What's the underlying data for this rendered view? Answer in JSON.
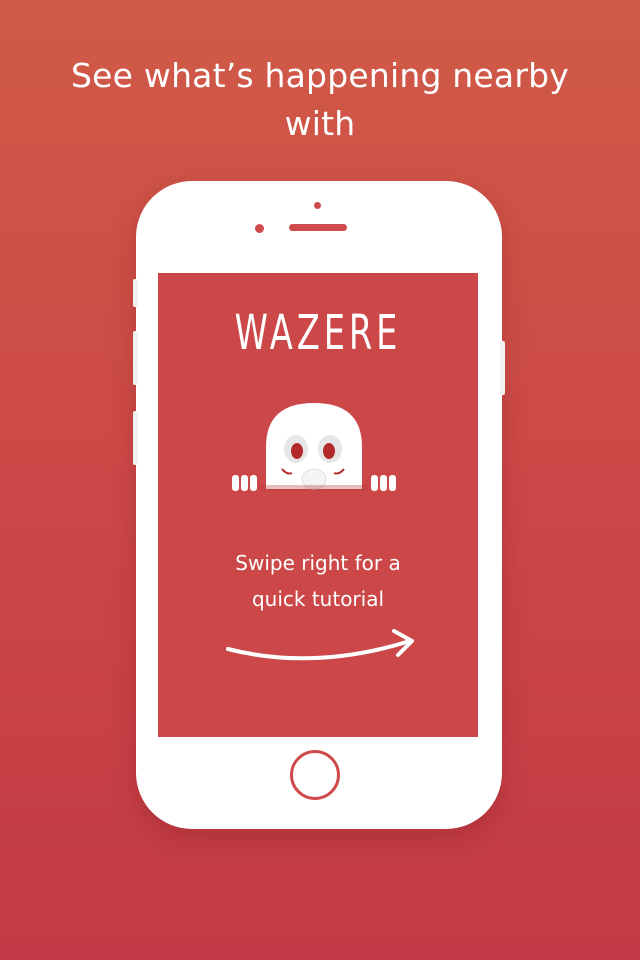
{
  "headline": {
    "line1": "See what’s happening nearby",
    "line2": "with"
  },
  "app": {
    "title": "WAZERE",
    "swipe_line1": "Swipe right for a",
    "swipe_line2": "quick tutorial"
  },
  "colors": {
    "background_top": "#d05a47",
    "background_bottom": "#c23a45",
    "screen": "#cc4848",
    "phone_body": "#ffffff"
  },
  "icons": {
    "mascot": "peeking-skull-icon",
    "arrow": "swipe-right-arrow-icon"
  }
}
